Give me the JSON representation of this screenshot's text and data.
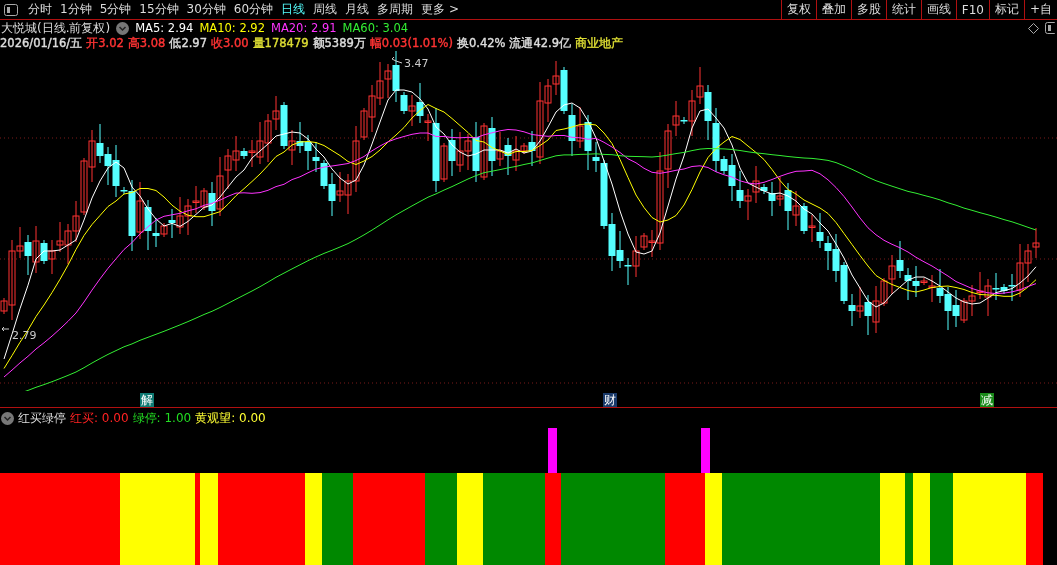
{
  "toolbar": {
    "periods": [
      {
        "label": "分时",
        "selected": false
      },
      {
        "label": "1分钟",
        "selected": false
      },
      {
        "label": "5分钟",
        "selected": false
      },
      {
        "label": "15分钟",
        "selected": false
      },
      {
        "label": "30分钟",
        "selected": false
      },
      {
        "label": "60分钟",
        "selected": false
      },
      {
        "label": "日线",
        "selected": true
      },
      {
        "label": "周线",
        "selected": false
      },
      {
        "label": "月线",
        "selected": false
      },
      {
        "label": "多周期",
        "selected": false
      },
      {
        "label": "更多 >",
        "selected": false
      }
    ],
    "tools": [
      "复权",
      "叠加",
      "多股",
      "统计",
      "画线",
      "F10",
      "标记",
      "+自"
    ]
  },
  "title": "大悦城(日线.前复权)",
  "moving_averages": [
    {
      "label": "MA5: 2.94",
      "color": "#ffffff"
    },
    {
      "label": "MA10: 2.92",
      "color": "#ffff00"
    },
    {
      "label": "MA20: 2.91",
      "color": "#ff33ff"
    },
    {
      "label": "MA60: 3.04",
      "color": "#33ee33"
    }
  ],
  "date": "2026/01/16/五",
  "quote": [
    {
      "text": "开3.02",
      "color": "#ff3333"
    },
    {
      "text": "高3.08",
      "color": "#ff3333"
    },
    {
      "text": "低2.97",
      "color": "#dddddd"
    },
    {
      "text": "收3.00",
      "color": "#ff3333"
    },
    {
      "text": "量178479",
      "color": "#dddd33"
    },
    {
      "text": "额5389万",
      "color": "#dddddd"
    },
    {
      "text": "幅0.03(1.01%)",
      "color": "#ff3333"
    },
    {
      "text": "换0.42%",
      "color": "#dddddd"
    },
    {
      "text": "流通42.9亿",
      "color": "#dddddd"
    },
    {
      "text": "商业地产",
      "color": "#dddd33"
    }
  ],
  "chart": {
    "high_label": "3.47",
    "low_label": "2.79"
  },
  "markers": [
    {
      "text": "解",
      "color": "#0e7a73"
    },
    {
      "text": "财",
      "color": "#1a3a6a"
    },
    {
      "text": "减",
      "color": "#1a8a1a"
    }
  ],
  "indicator": {
    "name": "红买绿停",
    "values": [
      {
        "text": "红买: 0.00",
        "color": "#ff2222"
      },
      {
        "text": "绿停: 1.00",
        "color": "#22dd22"
      },
      {
        "text": "黄观望: 0.00",
        "color": "#ffff33"
      }
    ]
  }
}
